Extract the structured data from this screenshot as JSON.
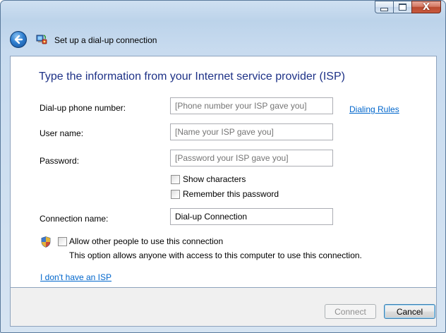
{
  "window": {
    "controls": {
      "minimize_icon": "minimize-icon",
      "maximize_icon": "maximize-icon",
      "close_glyph": "X"
    }
  },
  "navbar": {
    "back_icon": "back-arrow-icon",
    "wizard_icon": "dialup-connection-icon",
    "title": "Set up a dial-up connection"
  },
  "main": {
    "heading": "Type the information from your Internet service provider (ISP)",
    "phone": {
      "label": "Dial-up phone number:",
      "value": "",
      "placeholder": "[Phone number your ISP gave you]"
    },
    "dialing_rules_link": "Dialing Rules",
    "username": {
      "label": "User name:",
      "value": "",
      "placeholder": "[Name your ISP gave you]"
    },
    "password": {
      "label": "Password:",
      "value": "",
      "placeholder": "[Password your ISP gave you]"
    },
    "show_characters": {
      "label": "Show characters",
      "checked": false
    },
    "remember_password": {
      "label": "Remember this password",
      "checked": false
    },
    "connection_name": {
      "label": "Connection name:",
      "value": "Dial-up Connection"
    },
    "allow_others": {
      "label": "Allow other people to use this connection",
      "description": "This option allows anyone with access to this computer to use this connection.",
      "checked": false,
      "shield_icon": "uac-shield-icon"
    },
    "no_isp_link": "I don't have an ISP"
  },
  "footer": {
    "connect_label": "Connect",
    "cancel_label": "Cancel"
  },
  "colors": {
    "heading": "#1e3287",
    "link": "#0066cc",
    "close_button": "#c95a3e"
  }
}
